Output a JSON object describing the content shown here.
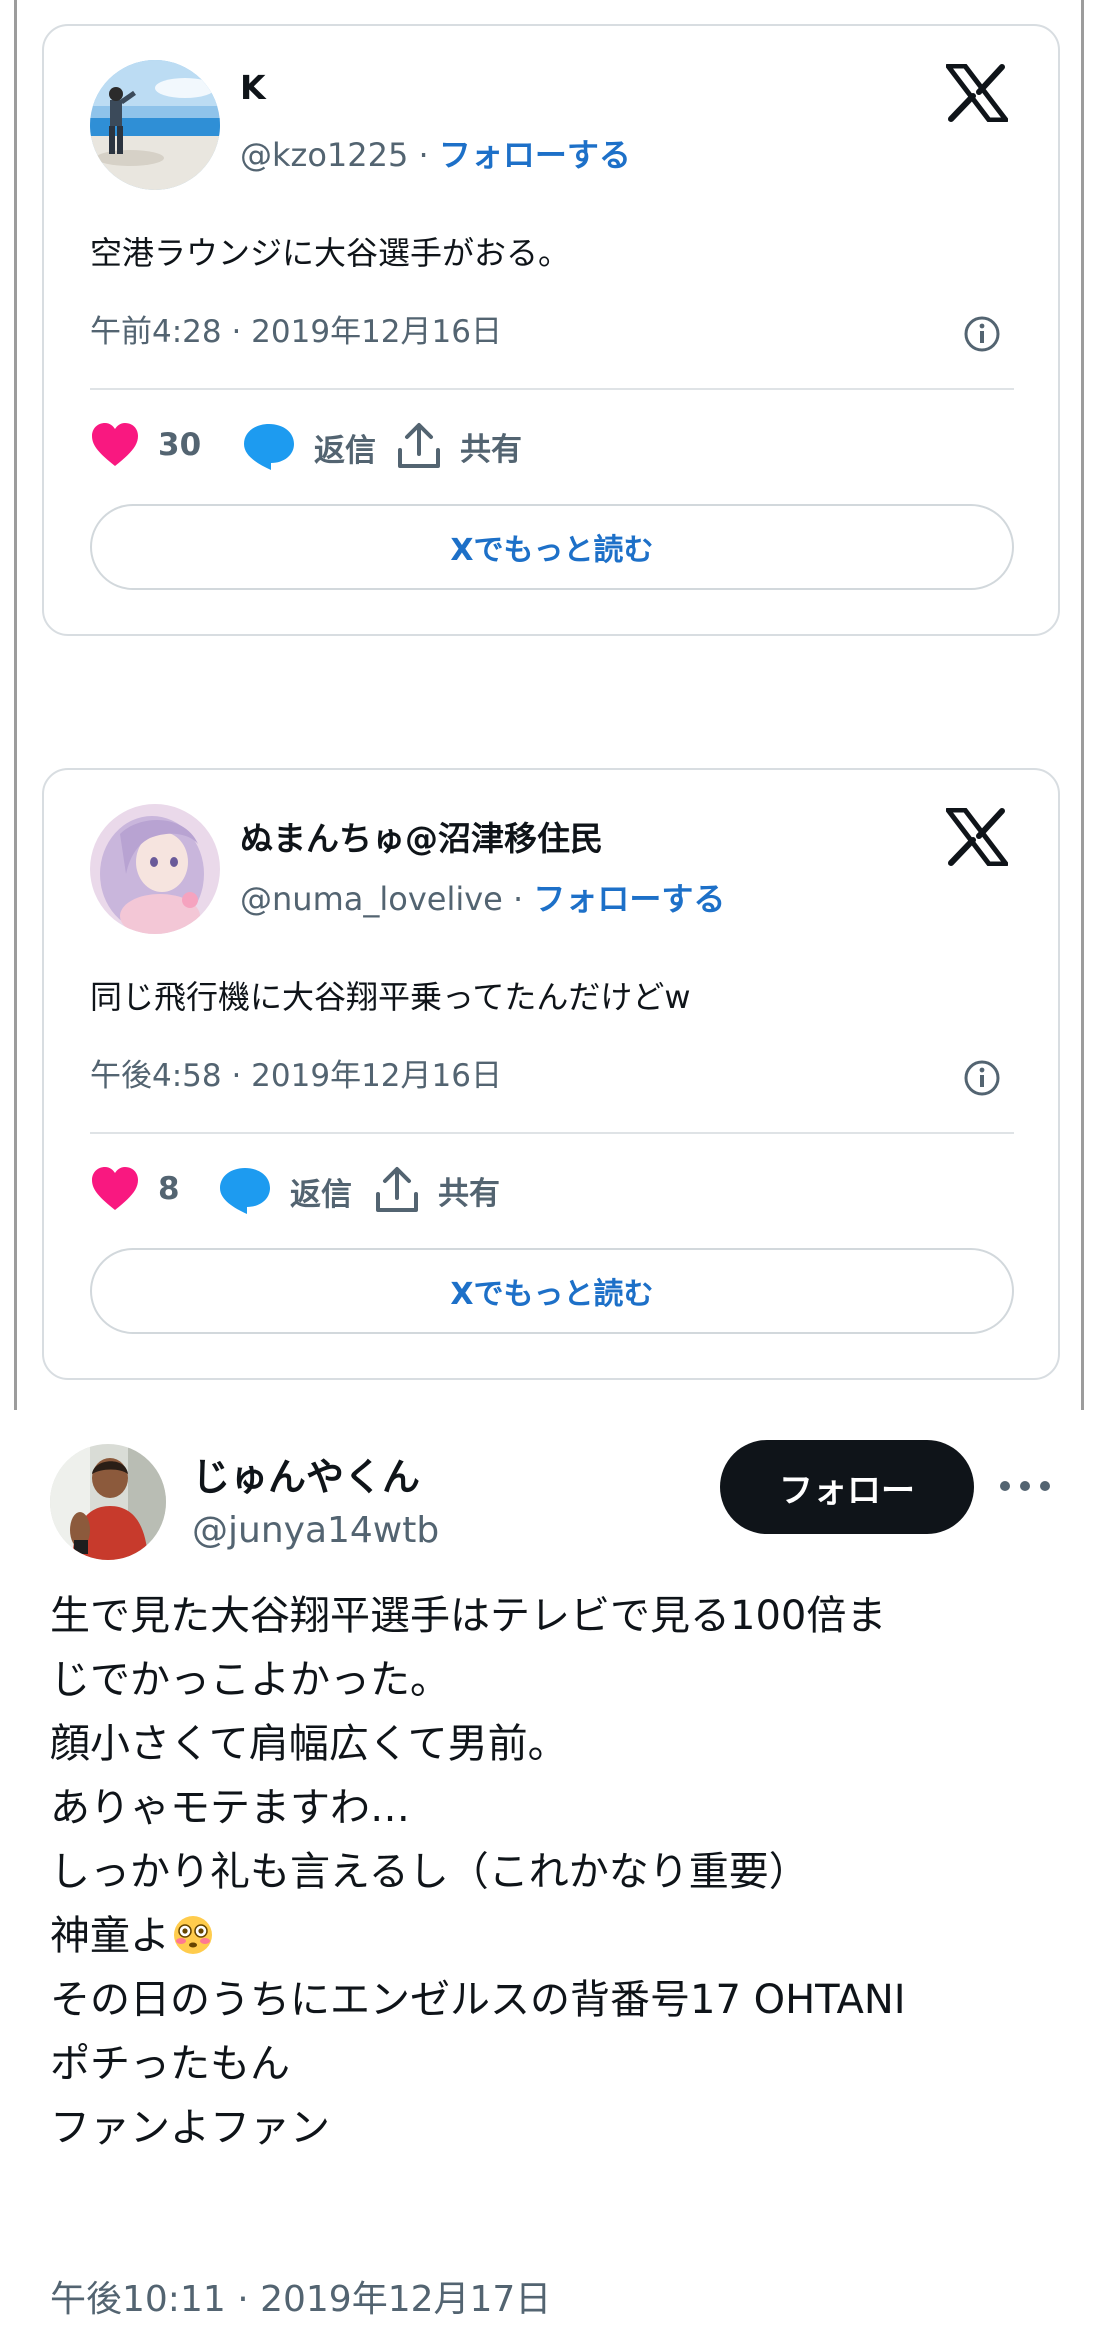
{
  "embeds": [
    {
      "display_name": "K",
      "handle": "@kzo1225",
      "separator": " · ",
      "follow_label": "フォローする",
      "text": "空港ラウンジに大谷選手がおる。",
      "timestamp": "午前4:28 · 2019年12月16日",
      "like_count": "30",
      "reply_label": "返信",
      "share_label": "共有",
      "read_more_label": "Xでもっと読む"
    },
    {
      "display_name": "ぬまんちゅ@沼津移住民",
      "handle": "@numa_lovelive",
      "separator": " · ",
      "follow_label": "フォローする",
      "text": "同じ飛行機に大谷翔平乗ってたんだけどw",
      "timestamp": "午後4:58 · 2019年12月16日",
      "like_count": "8",
      "reply_label": "返信",
      "share_label": "共有",
      "read_more_label": "Xでもっと読む"
    }
  ],
  "tweet": {
    "display_name": "じゅんやくん",
    "handle": "@junya14wtb",
    "follow_label": "フォロー",
    "lines": [
      "生で見た大谷翔平選手はテレビで見る100倍ま",
      "じでかっこよかった。",
      "顔小さくて肩幅広くて男前。",
      "ありゃモテますわ…",
      "しっかり礼も言えるし（これかなり重要）",
      "神童よ",
      "その日のうちにエンゼルスの背番号17 OHTANI",
      "ポチったもん",
      "ファンよファン"
    ],
    "emoji_icon": "flushed-face-icon",
    "timestamp": "午後10:11 · 2019年12月17日"
  },
  "colors": {
    "link_blue": "#1d70c8",
    "heart_pink": "#f91880",
    "reply_blue": "#1d9bf0",
    "muted_gray": "#536471",
    "border_gray": "#d8dde1",
    "text_black": "#0f1419"
  }
}
